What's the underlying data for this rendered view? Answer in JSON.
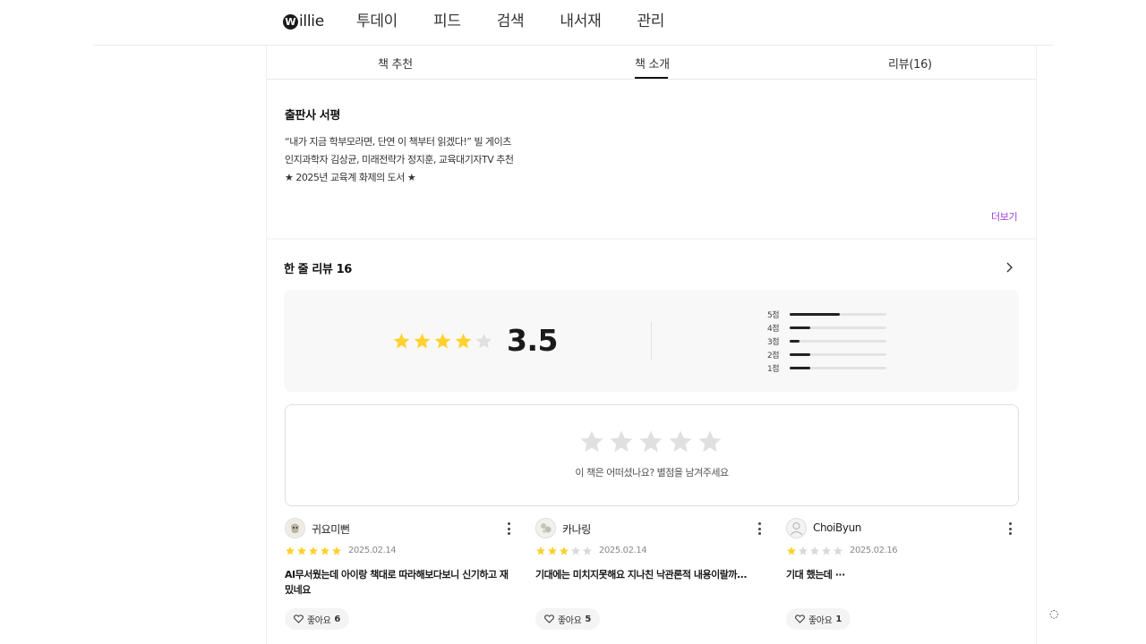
{
  "header": {
    "logo": "illie",
    "logo_mark": "W",
    "nav": [
      "투데이",
      "피드",
      "검색",
      "내서재",
      "관리"
    ],
    "active_nav": 0
  },
  "tabs": [
    {
      "label": "책 추천",
      "active": false
    },
    {
      "label": "책 소개",
      "active": true
    },
    {
      "label": "리뷰(16)",
      "active": false
    }
  ],
  "publisher": {
    "title": "출판사 서평",
    "lines": [
      "“내가 지금 학부모라면, 단연 이 책부터 읽겠다!” 빌 게이츠",
      "인지과학자 김상균, 미래전략가 정지훈, 교육대기자TV 추천",
      "★ 2025년 교육계 화제의 도서 ★"
    ],
    "more": "더보기"
  },
  "reviews": {
    "title": "한 줄 리뷰 16",
    "average": "3.5",
    "average_value": 3.5,
    "distribution": [
      {
        "label": "5점",
        "ratio": 0.52
      },
      {
        "label": "4점",
        "ratio": 0.21
      },
      {
        "label": "3점",
        "ratio": 0.1
      },
      {
        "label": "2점",
        "ratio": 0.21
      },
      {
        "label": "1점",
        "ratio": 0.21
      }
    ],
    "prompt": "이 책은 어떠셨나요? 별점을 남겨주세요",
    "items": [
      {
        "user": "귀요미뻔",
        "rating": 5,
        "date": "2025.02.14",
        "text": "AI무서웠는데 아이랑 책대로 따라해보다보니 신기하고 재밌네요",
        "like_label": "좋아요",
        "likes": "6"
      },
      {
        "user": "카나링",
        "rating": 3,
        "date": "2025.02.14",
        "text": "기대에는 미치지못해요 지나친 낙관론적 내용이랄까...",
        "like_label": "좋아요",
        "likes": "5"
      },
      {
        "user": "ChoiByun",
        "rating": 1,
        "date": "2025.02.16",
        "text": "기대 했는데 ···",
        "like_label": "좋아요",
        "likes": "1"
      }
    ]
  },
  "colors": {
    "star_on": "#fed12f",
    "star_off": "#d9d9d9",
    "star_big_off": "#e0e0e0",
    "accent": "#9c3cd9",
    "bar_fill": "#222222"
  }
}
